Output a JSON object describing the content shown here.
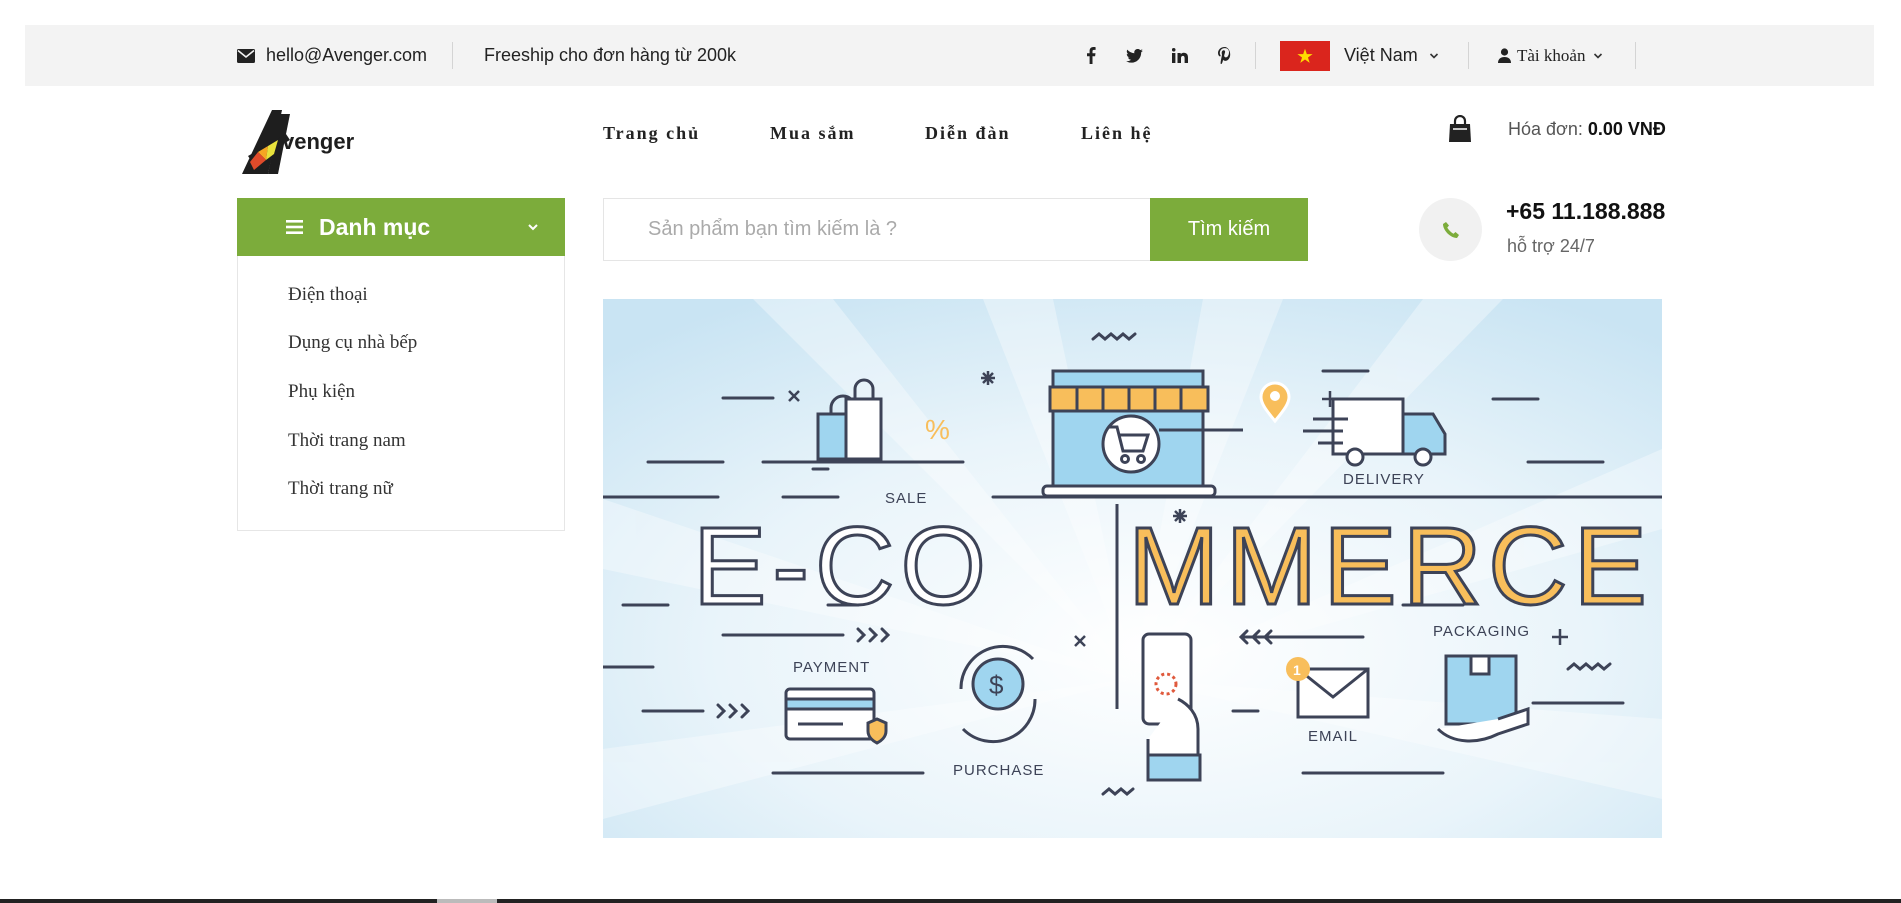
{
  "topbar": {
    "email": "hello@Avenger.com",
    "promo": "Freeship cho đơn hàng từ 200k",
    "social_icons": [
      "facebook-icon",
      "twitter-icon",
      "linkedin-icon",
      "pinterest-icon"
    ],
    "country": "Việt Nam",
    "account": "Tài khoản"
  },
  "header": {
    "logo_text": "venger",
    "logo_letter": "A",
    "nav": [
      "Trang chủ",
      "Mua sắm",
      "Diễn đàn",
      "Liên hệ"
    ],
    "bill_label": "Hóa đơn:",
    "bill_value": "0.00 VNĐ"
  },
  "category": {
    "title": "Danh mục",
    "items": [
      "Điện thoại",
      "Dụng cụ nhà bếp",
      "Phụ kiện",
      "Thời trang nam",
      "Thời trang nữ"
    ]
  },
  "search": {
    "placeholder": "Sản phẩm bạn tìm kiếm là ?",
    "button": "Tìm kiếm"
  },
  "hotline": {
    "number": "+65 11.188.888",
    "sub": "hỗ trợ 24/7"
  },
  "banner": {
    "headline_left": "E-CO",
    "headline_right": "MMERCE",
    "labels": {
      "sale": "SALE",
      "delivery": "DELIVERY",
      "payment": "PAYMENT",
      "purchase": "PURCHASE",
      "email": "EMAIL",
      "packaging": "PACKAGING",
      "email_badge": "1",
      "percent": "%",
      "dollar": "$"
    },
    "colors": {
      "accent": "#f8be5b",
      "line": "#3d4357",
      "light_blue": "#9fd5ef",
      "bg": "#e3f1f9"
    }
  },
  "colors": {
    "brand_green": "#7cac3b",
    "flag_red": "#da251d",
    "flag_star": "#ffde00"
  }
}
